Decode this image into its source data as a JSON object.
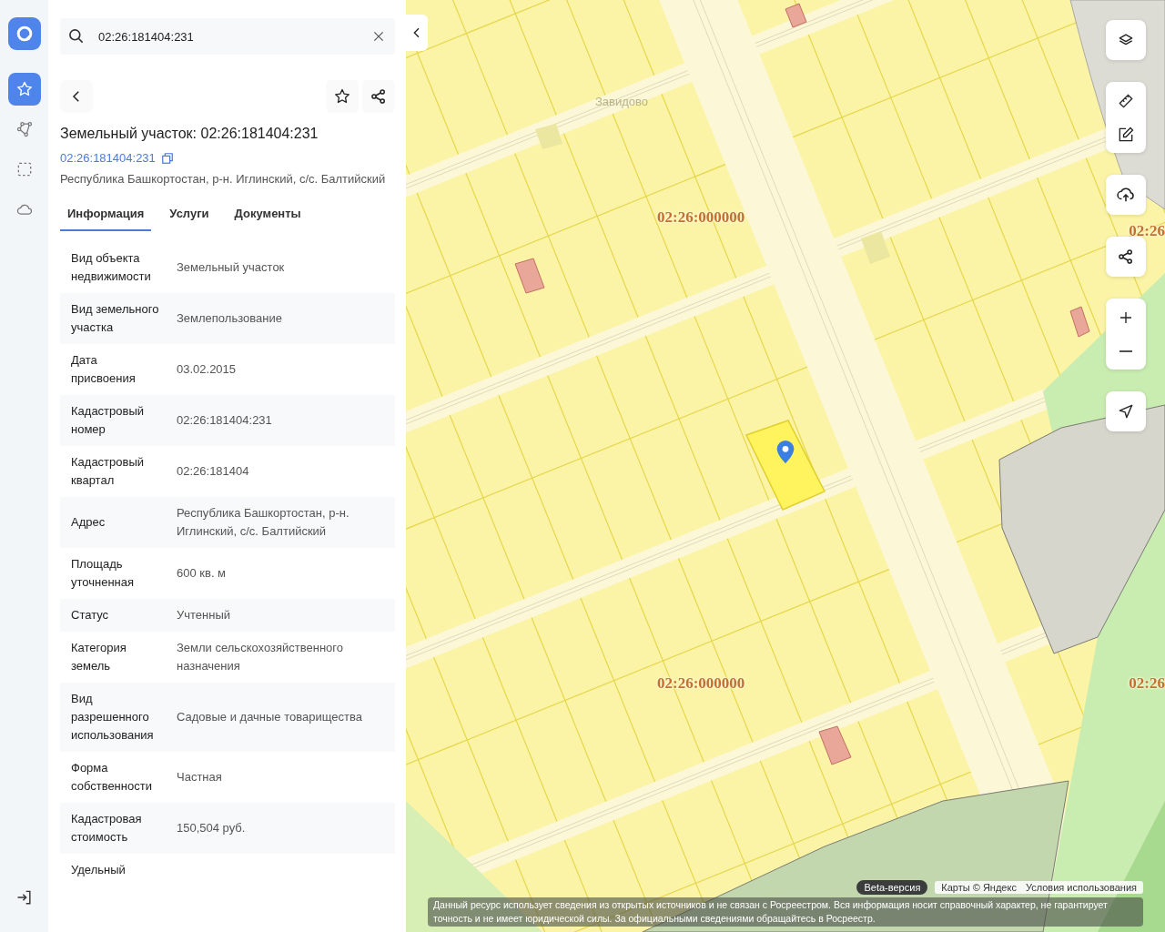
{
  "rail": {
    "items": [
      {
        "kind": "favorites",
        "selected": true
      },
      {
        "kind": "route",
        "selected": false
      },
      {
        "kind": "selection",
        "selected": false
      },
      {
        "kind": "cloud",
        "selected": false
      }
    ]
  },
  "search": {
    "value": "02:26:181404:231"
  },
  "object": {
    "title": "Земельный участок: 02:26:181404:231",
    "cadastral_number": "02:26:181404:231",
    "address": "Республика Башкортостан, р-н. Иглинский, с/с. Балтийский"
  },
  "tabs": [
    {
      "label": "Информация",
      "selected": true
    },
    {
      "label": "Услуги",
      "selected": false
    },
    {
      "label": "Документы",
      "selected": false
    }
  ],
  "properties": [
    {
      "label": "Вид объекта недвижимости",
      "value": "Земельный участок"
    },
    {
      "label": "Вид земельного участка",
      "value": "Землепользование"
    },
    {
      "label": "Дата присвоения",
      "value": "03.02.2015"
    },
    {
      "label": "Кадастровый номер",
      "value": "02:26:181404:231"
    },
    {
      "label": "Кадастровый квартал",
      "value": "02:26:181404"
    },
    {
      "label": "Адрес",
      "value": "Республика Башкортостан, р-н. Иглинский, с/с. Балтийский"
    },
    {
      "label": "Площадь уточненная",
      "value": "600 кв. м"
    },
    {
      "label": "Статус",
      "value": "Учтенный"
    },
    {
      "label": "Категория земель",
      "value": "Земли сельскохозяйственного назначения"
    },
    {
      "label": "Вид разрешенного использования",
      "value": "Садовые и дачные товарищества"
    },
    {
      "label": "Форма собственности",
      "value": "Частная"
    },
    {
      "label": "Кадастровая стоимость",
      "value": "150,504 руб."
    },
    {
      "label": "Удельный"
    }
  ],
  "map": {
    "labels": [
      {
        "kind": "place",
        "text": "Завидово"
      },
      {
        "kind": "quarter",
        "text": "02:26:000000"
      },
      {
        "kind": "quarter",
        "text": "02:26"
      },
      {
        "kind": "quarter",
        "text": "02:26:000000"
      },
      {
        "kind": "quarter",
        "text": "02:26"
      }
    ],
    "beta": "Beta-версия",
    "attribution": "Карты © Яндекс",
    "terms": "Условия использования",
    "disclaimer": "Данный ресурс использует сведения из открытых источников и не связан с Росреестром. Вся информация носит справочный характер, не гарантирует точность и не имеет юридической силы. За официальными сведениями обращайтесь в Росреестр."
  }
}
